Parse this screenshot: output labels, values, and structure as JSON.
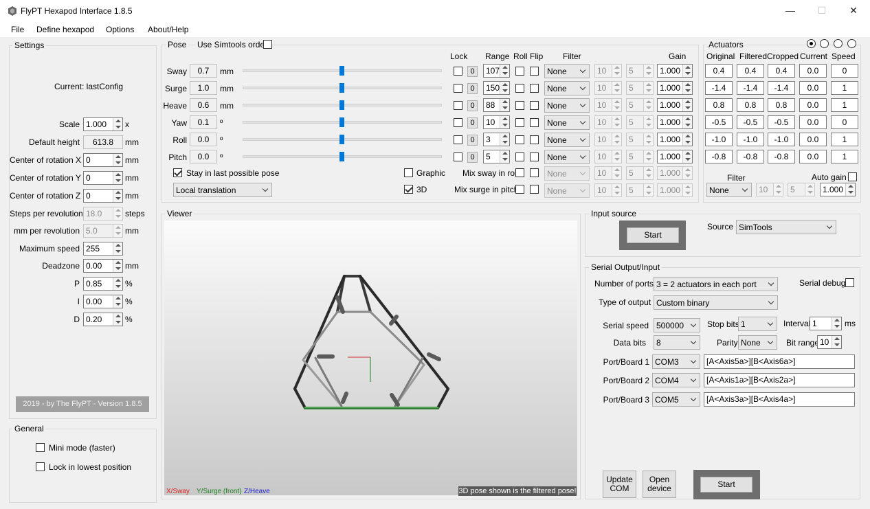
{
  "window": {
    "title": "FlyPT Hexapod Interface 1.8.5",
    "minimize": "—",
    "maximize": "☐",
    "close": "✕"
  },
  "menu": [
    "File",
    "Define hexapod",
    "Options",
    "About/Help"
  ],
  "settings": {
    "title": "Settings",
    "current": "Current: lastConfig",
    "rows": [
      {
        "label": "Scale",
        "value": "1.000",
        "unit": "x"
      },
      {
        "label": "Default height",
        "value": "613.8",
        "unit": "mm"
      },
      {
        "label": "Center of rotation X",
        "value": "0",
        "unit": "mm"
      },
      {
        "label": "Center of rotation Y",
        "value": "0",
        "unit": "mm"
      },
      {
        "label": "Center of rotation Z",
        "value": "0",
        "unit": "mm"
      },
      {
        "label": "Steps per revolution",
        "value": "18.0",
        "unit": "steps"
      },
      {
        "label": "mm per revolution",
        "value": "5.0",
        "unit": "mm"
      },
      {
        "label": "Maximum speed",
        "value": "255",
        "unit": ""
      },
      {
        "label": "Deadzone",
        "value": "0.00",
        "unit": "mm"
      },
      {
        "label": "P",
        "value": "0.85",
        "unit": "%"
      },
      {
        "label": "I",
        "value": "0.00",
        "unit": "%"
      },
      {
        "label": "D",
        "value": "0.20",
        "unit": "%"
      }
    ],
    "footer": "2019 - by The FlyPT - Version 1.8.5"
  },
  "general": {
    "title": "General",
    "mini_mode": "Mini mode (faster)",
    "lock_lowest": "Lock in lowest position"
  },
  "pose": {
    "title": "Pose",
    "use_simtools": "Use Simtools order",
    "headers": {
      "lock": "Lock",
      "range": "Range",
      "roll": "Roll",
      "flip": "Flip",
      "filter": "Filter",
      "gain": "Gain"
    },
    "rows": [
      {
        "label": "Sway",
        "value": "0.7",
        "unit": "mm",
        "slider": 0.5,
        "lock": "0",
        "range": "107",
        "filter": "None",
        "f1": "10",
        "f2": "5",
        "gain": "1.000"
      },
      {
        "label": "Surge",
        "value": "1.0",
        "unit": "mm",
        "slider": 0.5,
        "lock": "0",
        "range": "150",
        "filter": "None",
        "f1": "10",
        "f2": "5",
        "gain": "1.000"
      },
      {
        "label": "Heave",
        "value": "0.6",
        "unit": "mm",
        "slider": 0.5,
        "lock": "0",
        "range": "88",
        "filter": "None",
        "f1": "10",
        "f2": "5",
        "gain": "1.000"
      },
      {
        "label": "Yaw",
        "value": "0.1",
        "unit": "º",
        "slider": 0.5,
        "lock": "0",
        "range": "10",
        "filter": "None",
        "f1": "10",
        "f2": "5",
        "gain": "1.000"
      },
      {
        "label": "Roll",
        "value": "0.0",
        "unit": "º",
        "slider": 0.5,
        "lock": "0",
        "range": "3",
        "filter": "None",
        "f1": "10",
        "f2": "5",
        "gain": "1.000"
      },
      {
        "label": "Pitch",
        "value": "0.0",
        "unit": "º",
        "slider": 0.5,
        "lock": "0",
        "range": "5",
        "filter": "None",
        "f1": "10",
        "f2": "5",
        "gain": "1.000"
      }
    ],
    "stay_last": "Stay in last possible pose",
    "translation": "Local translation",
    "graphic": "Graphic",
    "three_d": "3D",
    "mix_sway": "Mix sway in roll",
    "mix_surge": "Mix surge in pitch",
    "mix_filter": "None",
    "mix_f1": "10",
    "mix_f2": "5",
    "mix_gain": "1.000"
  },
  "actuators": {
    "title": "Actuators",
    "headers": [
      "Original",
      "Filtered",
      "Cropped",
      "Current",
      "Speed"
    ],
    "rows": [
      [
        "0.4",
        "0.4",
        "0.4",
        "0.0",
        "0"
      ],
      [
        "-1.4",
        "-1.4",
        "-1.4",
        "0.0",
        "1"
      ],
      [
        "0.8",
        "0.8",
        "0.8",
        "0.0",
        "1"
      ],
      [
        "-0.5",
        "-0.5",
        "-0.5",
        "0.0",
        "0"
      ],
      [
        "-1.0",
        "-1.0",
        "-1.0",
        "0.0",
        "1"
      ],
      [
        "-0.8",
        "-0.8",
        "-0.8",
        "0.0",
        "1"
      ]
    ],
    "filter_label": "Filter",
    "filter_value": "None",
    "f1": "10",
    "f2": "5",
    "auto_gain": "Auto gain",
    "gain": "1.000"
  },
  "viewer": {
    "title": "Viewer",
    "legend_x": "X/Sway",
    "legend_y": "Y/Surge (front)",
    "legend_z": "Z/Heave",
    "note": "3D pose shown is the filtered pose!",
    "colors": {
      "x": "#e02020",
      "y": "#208020",
      "z": "#2020d0"
    }
  },
  "input_source": {
    "title": "Input source",
    "start": "Start",
    "source_label": "Source",
    "source_value": "SimTools"
  },
  "serial": {
    "title": "Serial Output/Input",
    "ports_label": "Number of ports",
    "ports_value": "3 = 2 actuators in each port",
    "debug_label": "Serial debug",
    "type_label": "Type of output",
    "type_value": "Custom binary",
    "speed_label": "Serial speed",
    "speed_value": "500000",
    "stopbits_label": "Stop bits",
    "stopbits_value": "1",
    "interval_label": "Interval",
    "interval_value": "1",
    "interval_unit": "ms",
    "databits_label": "Data bits",
    "databits_value": "8",
    "parity_label": "Parity",
    "parity_value": "None",
    "bitrange_label": "Bit range",
    "bitrange_value": "10",
    "boards": [
      {
        "label": "Port/Board 1",
        "port": "COM3",
        "format": "[A<Axis5a>][B<Axis6a>]"
      },
      {
        "label": "Port/Board 2",
        "port": "COM4",
        "format": "[A<Axis1a>][B<Axis2a>]"
      },
      {
        "label": "Port/Board 3",
        "port": "COM5",
        "format": "[A<Axis3a>][B<Axis4a>]"
      }
    ],
    "update_com": "Update COM",
    "open_device": "Open device",
    "start": "Start"
  }
}
